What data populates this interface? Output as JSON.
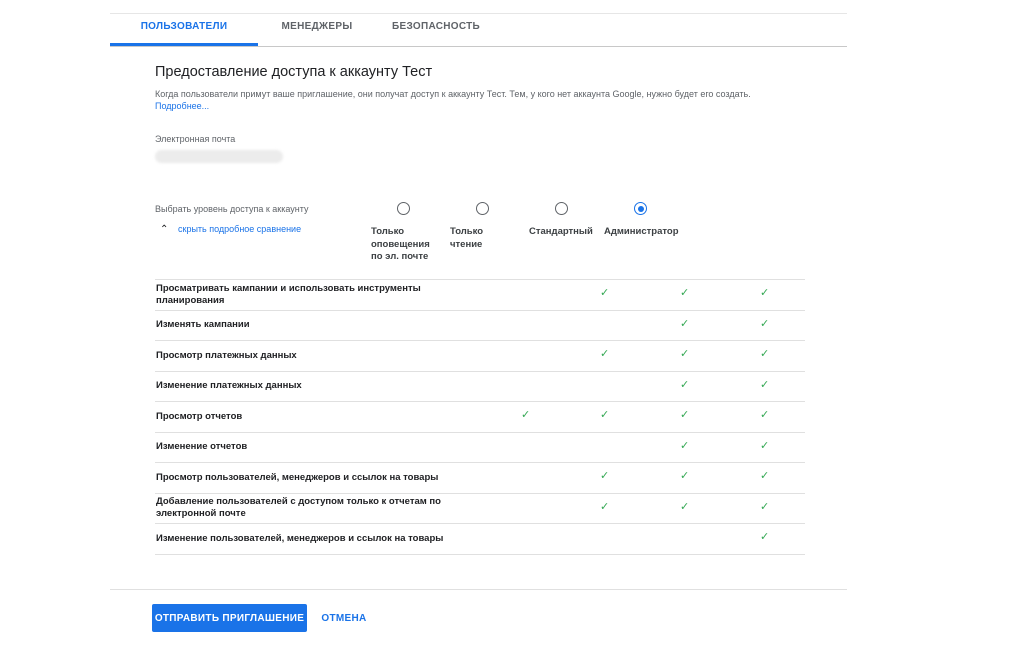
{
  "tabs": [
    {
      "label": "ПОЛЬЗОВАТЕЛИ",
      "active": true
    },
    {
      "label": "МЕНЕДЖЕРЫ",
      "active": false
    },
    {
      "label": "БЕЗОПАСНОСТЬ",
      "active": false
    }
  ],
  "title": "Предоставление доступа к аккаунту Тест",
  "description": "Когда пользователи примут ваше приглашение, они получат доступ к аккаунту Тест. Тем, у кого нет аккаунта Google, нужно будет его создать.",
  "learn_more": "Подробнее...",
  "email": {
    "label": "Электронная почта",
    "value": "email-redacted"
  },
  "access_level": {
    "label": "Выбрать уровень доступа к аккаунту",
    "toggle_label": "скрыть подробное сравнение",
    "selected_index": 3,
    "levels": [
      {
        "label": "Только оповещения по эл. почте"
      },
      {
        "label": "Только чтение"
      },
      {
        "label": "Стандартный"
      },
      {
        "label": "Администратор"
      }
    ]
  },
  "permissions": [
    {
      "label": "Просматривать кампании и использовать инструменты планирования",
      "checks": [
        false,
        true,
        true,
        true
      ]
    },
    {
      "label": "Изменять кампании",
      "checks": [
        false,
        false,
        true,
        true
      ]
    },
    {
      "label": "Просмотр платежных данных",
      "checks": [
        false,
        true,
        true,
        true
      ]
    },
    {
      "label": "Изменение платежных данных",
      "checks": [
        false,
        false,
        true,
        true
      ]
    },
    {
      "label": "Просмотр отчетов",
      "checks": [
        true,
        true,
        true,
        true
      ]
    },
    {
      "label": "Изменение отчетов",
      "checks": [
        false,
        false,
        true,
        true
      ]
    },
    {
      "label": "Просмотр пользователей, менеджеров и ссылок на товары",
      "checks": [
        false,
        true,
        true,
        true
      ]
    },
    {
      "label": "Добавление пользователей с доступом только к отчетам по электронной почте",
      "checks": [
        false,
        true,
        true,
        true
      ]
    },
    {
      "label": "Изменение пользователей, менеджеров и ссылок на товары",
      "checks": [
        false,
        false,
        false,
        true
      ]
    }
  ],
  "buttons": {
    "send": "ОТПРАВИТЬ ПРИГЛАШЕНИЕ",
    "cancel": "ОТМЕНА"
  },
  "colors": {
    "accent": "#1a73e8",
    "check": "#34a853"
  },
  "icons": {
    "check": "check-icon",
    "collapse": "chevron-up-icon"
  }
}
